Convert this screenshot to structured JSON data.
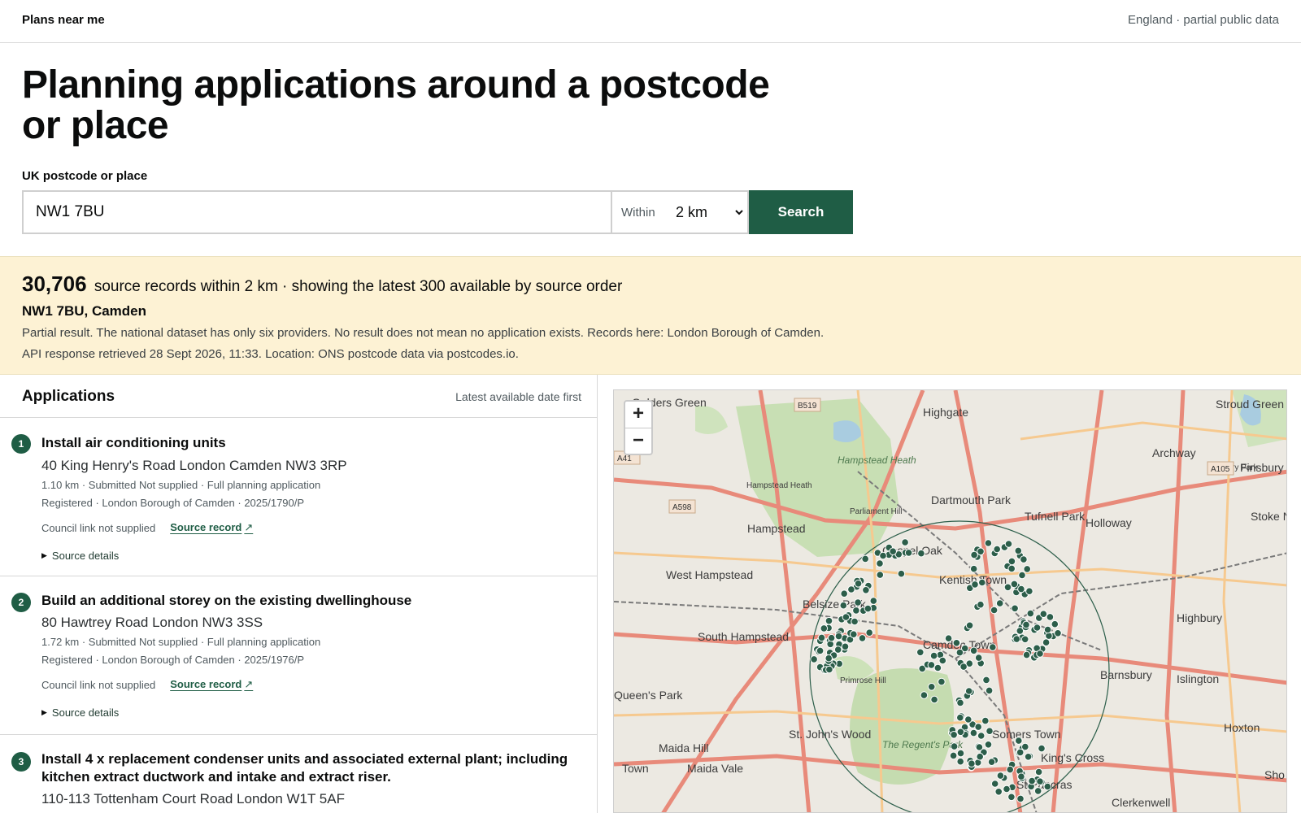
{
  "header": {
    "brand": "Plans near me",
    "coverage": "England · partial public data"
  },
  "search": {
    "title": "Planning applications around a postcode or place",
    "label": "UK postcode or place",
    "value": "NW1 7BU",
    "within_label": "Within",
    "radius_selected": "2 km",
    "button": "Search"
  },
  "summary": {
    "count": "30,706",
    "text": "source records within 2 km · showing the latest 300 available by source order",
    "place": "NW1 7BU, Camden",
    "partial_note": "Partial result. The national dataset has only six providers. No result does not mean no application exists. Records here: London Borough of Camden.",
    "api_note": "API response retrieved 28 Sept 2026, 11:33. Location: ONS postcode data via postcodes.io."
  },
  "list": {
    "title": "Applications",
    "sort": "Latest available date first",
    "items": [
      {
        "num": "1",
        "title": "Install air conditioning units",
        "address": "40 King Henry's Road London Camden NW3 3RP",
        "meta1": "1.10 km · Submitted Not supplied · Full planning application",
        "meta2": "Registered · London Borough of Camden · 2025/1790/P",
        "council_link": "Council link not supplied",
        "source_link": "Source record",
        "details": "Source details"
      },
      {
        "num": "2",
        "title": "Build an additional storey on the existing dwellinghouse",
        "address": "80 Hawtrey Road London NW3 3SS",
        "meta1": "1.72 km · Submitted Not supplied · Full planning application",
        "meta2": "Registered · London Borough of Camden · 2025/1976/P",
        "council_link": "Council link not supplied",
        "source_link": "Source record",
        "details": "Source details"
      },
      {
        "num": "3",
        "title": "Install 4 x replacement condenser units and associated external plant; including kitchen extract ductwork and intake and extract riser.",
        "address": "110-113 Tottenham Court Road London W1T 5AF"
      }
    ]
  },
  "map": {
    "zoom_in": "+",
    "zoom_out": "−",
    "marker_color": "#2c5e4a",
    "labels": [
      "Golders Green",
      "Highgate",
      "Stroud Green",
      "Finsbury Park",
      "Archway",
      "Finsbury Park",
      "Hampstead Heath",
      "Hampstead Heath",
      "Dartmouth Park",
      "Tufnell Park",
      "Holloway",
      "Stoke Ne",
      "Parliament Hill",
      "Hampstead",
      "Gospel Oak",
      "West Hampstead",
      "Kentish Town",
      "Belsize Park",
      "Highbury",
      "South Hampstead",
      "Camden Town",
      "Barnsbury",
      "Islington",
      "Primrose Hill",
      "Queen's Park",
      "St. John's Wood",
      "Somers Town",
      "Hoxton",
      "Maida Hill",
      "Maida Vale",
      "King's Cross",
      "The Regent's Park",
      "Town",
      "St Pancras",
      "Clerkenwell",
      "Sho"
    ],
    "road_badges": [
      "B519",
      "A598",
      "A105",
      "A41"
    ]
  }
}
